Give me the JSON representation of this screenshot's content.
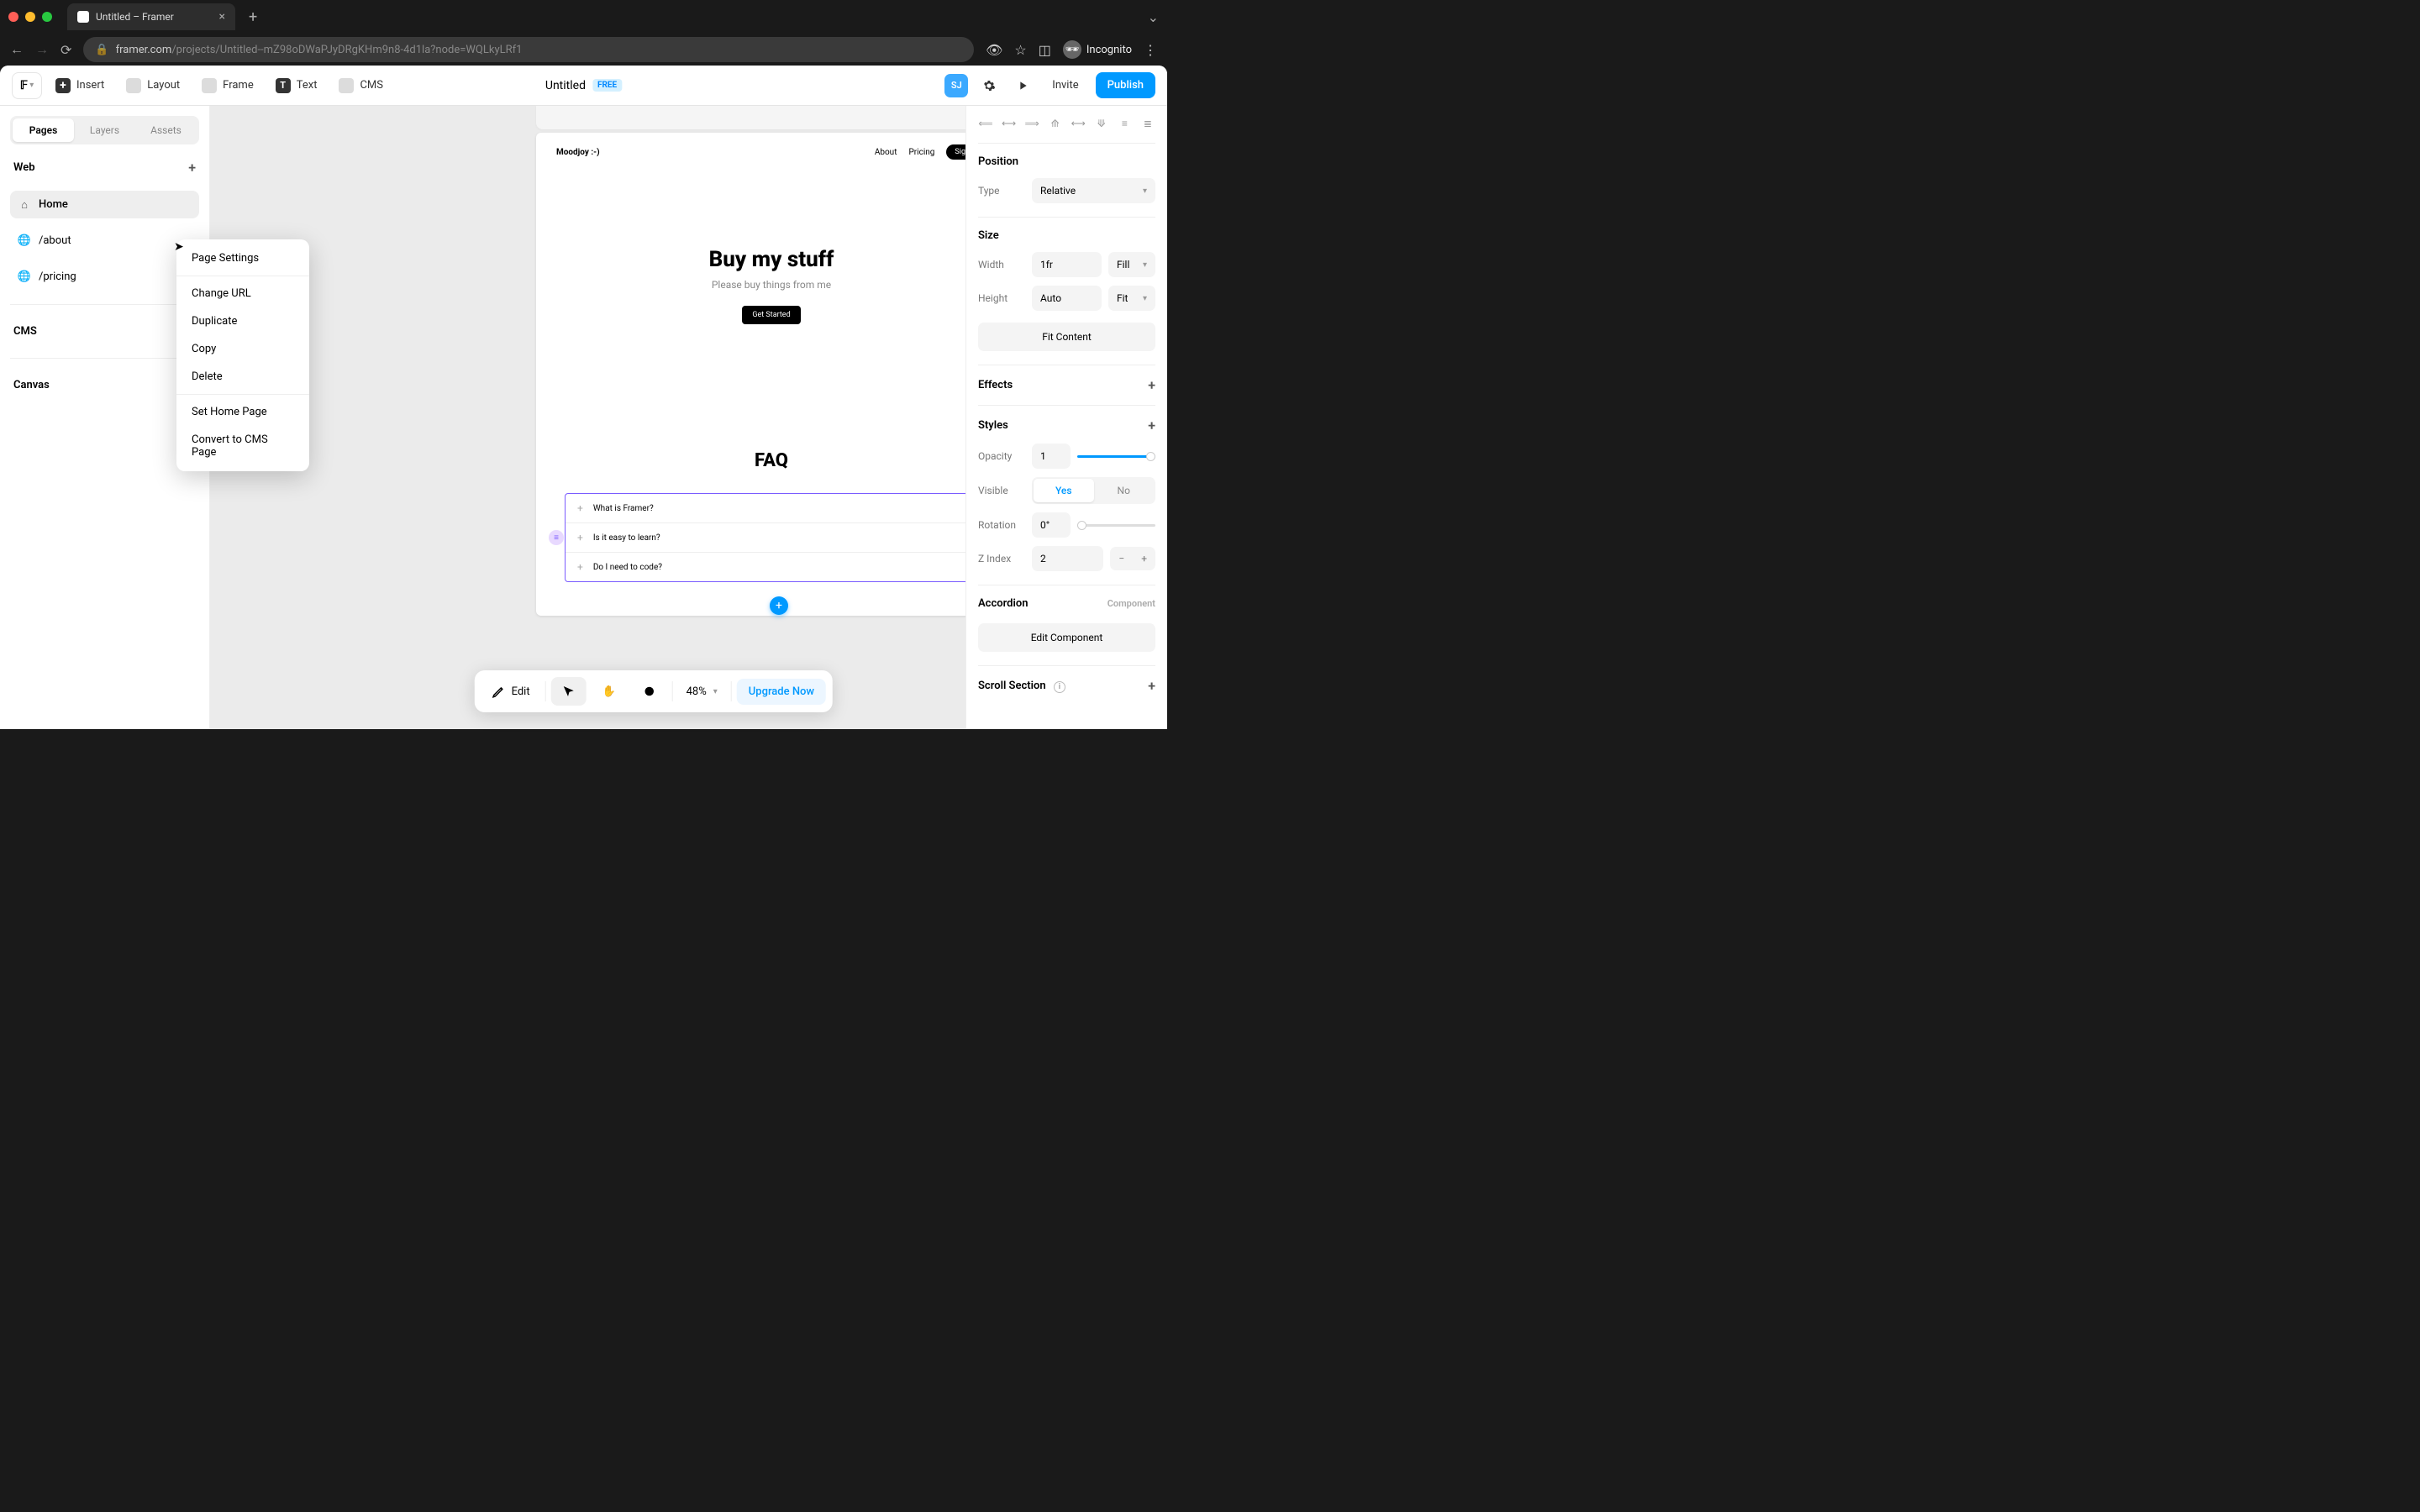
{
  "browser": {
    "tab_title": "Untitled – Framer",
    "url_host": "framer.com",
    "url_path": "/projects/Untitled--mZ98oDWaPJyDRgKHm9n8-4d1la?node=WQLkyLRf1",
    "incognito_label": "Incognito"
  },
  "toolbar": {
    "insert": "Insert",
    "layout": "Layout",
    "frame": "Frame",
    "text": "Text",
    "cms": "CMS",
    "doc_title": "Untitled",
    "plan_badge": "FREE",
    "avatar_initials": "SJ",
    "invite": "Invite",
    "publish": "Publish"
  },
  "left_panel": {
    "tabs": [
      "Pages",
      "Layers",
      "Assets"
    ],
    "active_tab": 0,
    "web_header": "Web",
    "pages": [
      {
        "icon": "home",
        "label": "Home",
        "active": true
      },
      {
        "icon": "globe",
        "label": "/about",
        "active": false
      },
      {
        "icon": "globe",
        "label": "/pricing",
        "active": false
      }
    ],
    "cms_header": "CMS",
    "canvas_header": "Canvas"
  },
  "context_menu": {
    "items_top": [
      "Page Settings"
    ],
    "items_mid": [
      "Change URL",
      "Duplicate",
      "Copy",
      "Delete"
    ],
    "items_bot": [
      "Set Home Page",
      "Convert to CMS Page"
    ]
  },
  "canvas": {
    "mock": {
      "logo": "Moodjoy :-)",
      "nav": [
        "About",
        "Pricing"
      ],
      "signup": "Signup",
      "hero_title": "Buy my stuff",
      "hero_sub": "Please buy things from me",
      "hero_cta": "Get Started",
      "faq_title": "FAQ",
      "faq_items": [
        "What is Framer?",
        "Is it easy to learn?",
        "Do I need to code?"
      ]
    }
  },
  "float_bar": {
    "edit": "Edit",
    "zoom": "48%",
    "upgrade": "Upgrade Now"
  },
  "right_panel": {
    "position_title": "Position",
    "type_label": "Type",
    "type_value": "Relative",
    "size_title": "Size",
    "width_label": "Width",
    "width_value": "1fr",
    "width_mode": "Fill",
    "height_label": "Height",
    "height_value": "Auto",
    "height_mode": "Fit",
    "fit_content": "Fit Content",
    "effects_title": "Effects",
    "styles_title": "Styles",
    "opacity_label": "Opacity",
    "opacity_value": "1",
    "visible_label": "Visible",
    "visible_yes": "Yes",
    "visible_no": "No",
    "rotation_label": "Rotation",
    "rotation_value": "0°",
    "zindex_label": "Z Index",
    "zindex_value": "2",
    "accordion_title": "Accordion",
    "component_label": "Component",
    "edit_component": "Edit Component",
    "scroll_section_title": "Scroll Section"
  }
}
